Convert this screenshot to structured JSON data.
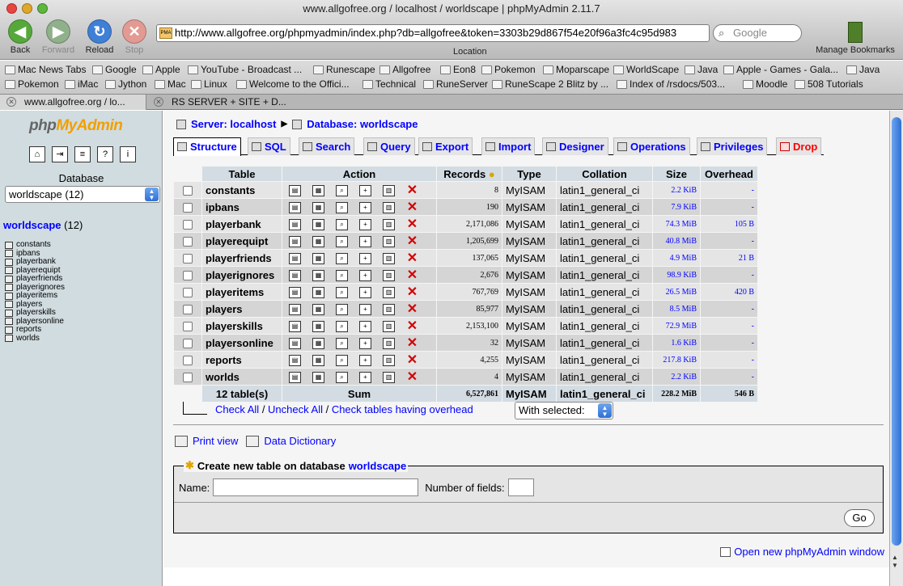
{
  "window": {
    "title": "www.allgofree.org / localhost / worldscape | phpMyAdmin 2.11.7"
  },
  "toolbar": {
    "back_label": "Back",
    "forward_label": "Forward",
    "reload_label": "Reload",
    "stop_label": "Stop",
    "url": "http://www.allgofree.org/phpmyadmin/index.php?db=allgofree&token=3303b29d867f54e20f96a3fc4c95d983",
    "url_caption": "Location",
    "search_placeholder": "Google",
    "bookmarks_label": "Manage Bookmarks"
  },
  "bookmarks": {
    "row1": [
      "Mac News Tabs",
      "Google",
      "Apple",
      "YouTube - Broadcast ...",
      "Runescape",
      "Allgofree",
      "Eon8",
      "Pokemon",
      "Moparscape",
      "WorldScape",
      "Java",
      "Apple - Games - Gala...",
      "Java"
    ],
    "row2": [
      "Pokemon",
      "iMac",
      "Jython",
      "Mac",
      "Linux",
      "Welcome to the Offici...",
      "Technical",
      "RuneServer",
      "RuneScape 2 Blitz by ...",
      "Index of /rsdocs/503...",
      "Moodle",
      "508 Tutorials"
    ]
  },
  "tabs": [
    {
      "label": "www.allgofree.org / lo..."
    },
    {
      "label": "RS SERVER + SITE + D..."
    }
  ],
  "sidebar": {
    "logo_part1": "php",
    "logo_part2": "MyAdmin",
    "database_label": "Database",
    "database_selected": "worldscape (12)",
    "db_link": "worldscape",
    "db_count": "(12)",
    "tables": [
      "constants",
      "ipbans",
      "playerbank",
      "playerequipt",
      "playerfriends",
      "playerignores",
      "playeritems",
      "players",
      "playerskills",
      "playersonline",
      "reports",
      "worlds"
    ]
  },
  "breadcrumb": {
    "server": "Server: localhost",
    "database": "Database: worldscape"
  },
  "subtabs": [
    "Structure",
    "SQL",
    "Search",
    "Query",
    "Export",
    "Import",
    "Designer",
    "Operations",
    "Privileges",
    "Drop"
  ],
  "table": {
    "headers": {
      "table": "Table",
      "action": "Action",
      "records": "Records",
      "type": "Type",
      "collation": "Collation",
      "size": "Size",
      "overhead": "Overhead"
    },
    "rows": [
      {
        "name": "constants",
        "records": "8",
        "type": "MyISAM",
        "collation": "latin1_general_ci",
        "size": "2.2 KiB",
        "overhead": "-"
      },
      {
        "name": "ipbans",
        "records": "190",
        "type": "MyISAM",
        "collation": "latin1_general_ci",
        "size": "7.9 KiB",
        "overhead": "-"
      },
      {
        "name": "playerbank",
        "records": "2,171,086",
        "type": "MyISAM",
        "collation": "latin1_general_ci",
        "size": "74.3 MiB",
        "overhead": "105 B"
      },
      {
        "name": "playerequipt",
        "records": "1,205,699",
        "type": "MyISAM",
        "collation": "latin1_general_ci",
        "size": "40.8 MiB",
        "overhead": "-"
      },
      {
        "name": "playerfriends",
        "records": "137,065",
        "type": "MyISAM",
        "collation": "latin1_general_ci",
        "size": "4.9 MiB",
        "overhead": "21 B"
      },
      {
        "name": "playerignores",
        "records": "2,676",
        "type": "MyISAM",
        "collation": "latin1_general_ci",
        "size": "98.9 KiB",
        "overhead": "-"
      },
      {
        "name": "playeritems",
        "records": "767,769",
        "type": "MyISAM",
        "collation": "latin1_general_ci",
        "size": "26.5 MiB",
        "overhead": "420 B"
      },
      {
        "name": "players",
        "records": "85,977",
        "type": "MyISAM",
        "collation": "latin1_general_ci",
        "size": "8.5 MiB",
        "overhead": "-"
      },
      {
        "name": "playerskills",
        "records": "2,153,100",
        "type": "MyISAM",
        "collation": "latin1_general_ci",
        "size": "72.9 MiB",
        "overhead": "-"
      },
      {
        "name": "playersonline",
        "records": "32",
        "type": "MyISAM",
        "collation": "latin1_general_ci",
        "size": "1.6 KiB",
        "overhead": "-"
      },
      {
        "name": "reports",
        "records": "4,255",
        "type": "MyISAM",
        "collation": "latin1_general_ci",
        "size": "217.8 KiB",
        "overhead": "-"
      },
      {
        "name": "worlds",
        "records": "4",
        "type": "MyISAM",
        "collation": "latin1_general_ci",
        "size": "2.2 KiB",
        "overhead": "-"
      }
    ],
    "summary": {
      "count": "12 table(s)",
      "sum_label": "Sum",
      "records": "6,527,861",
      "type": "MyISAM",
      "collation": "latin1_general_ci",
      "size": "228.2 MiB",
      "overhead": "546 B"
    }
  },
  "checkall": {
    "check_all": "Check All",
    "sep1": " / ",
    "uncheck_all": "Uncheck All",
    "sep2": " / ",
    "check_overhead": "Check tables having overhead",
    "with_selected": "With selected:"
  },
  "links": {
    "print_view": "Print view",
    "data_dictionary": "Data Dictionary"
  },
  "create_table": {
    "legend": "Create new table on database",
    "db": "worldscape",
    "name_label": "Name:",
    "name_value": "",
    "fields_label": "Number of fields:",
    "fields_value": "",
    "go_label": "Go"
  },
  "new_window_link": "Open new phpMyAdmin window"
}
